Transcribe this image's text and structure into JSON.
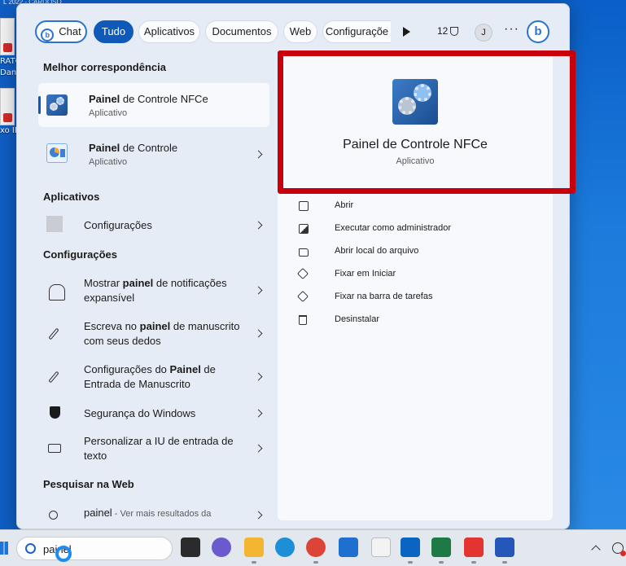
{
  "desktop": {
    "top_text": "L 2022 - CARDOSO",
    "labels": [
      "RATO",
      "Danie",
      "xo II"
    ]
  },
  "topbar": {
    "chat_label": "Chat",
    "chat_icon_glyph": "b",
    "tabs": [
      "Tudo",
      "Aplicativos",
      "Documentos",
      "Web",
      "Configuraçõe"
    ],
    "active_tab": "Tudo",
    "points": "12",
    "avatar_initial": "J",
    "more_glyph": "···",
    "bing_glyph": "b"
  },
  "left": {
    "best_match_heading": "Melhor correspondência",
    "best_match": {
      "title_bold": "Painel",
      "title_rest": " de Controle NFCe",
      "subtitle": "Aplicativo"
    },
    "second_match": {
      "title_bold": "Painel",
      "title_rest": " de Controle",
      "subtitle": "Aplicativo"
    },
    "apps_heading": "Aplicativos",
    "apps": [
      {
        "label": "Configurações"
      }
    ],
    "settings_heading": "Configurações",
    "settings": [
      {
        "before": "Mostrar ",
        "bold": "painel",
        "after": " de notificações expansível",
        "icon": "bell-icon"
      },
      {
        "before": "Escreva no ",
        "bold": "painel",
        "after": " de manuscrito com seus dedos",
        "icon": "pen-icon"
      },
      {
        "before": "Configurações do ",
        "bold": "Painel",
        "after": " de Entrada de Manuscrito",
        "icon": "pen-icon"
      },
      {
        "before": "Segurança do Windows",
        "bold": "",
        "after": "",
        "icon": "shield-icon"
      },
      {
        "before": "Personalizar a IU de entrada de texto",
        "bold": "",
        "after": "",
        "icon": "keyboard-icon"
      }
    ],
    "web_heading": "Pesquisar na Web",
    "web": {
      "term": "painel",
      "rest": " - Ver mais resultados da"
    }
  },
  "detail": {
    "app_name": "Painel de Controle NFCe",
    "app_type": "Aplicativo",
    "actions": [
      {
        "label": "Abrir",
        "icon": "open-icon"
      },
      {
        "label": "Executar como administrador",
        "icon": "admin-icon"
      },
      {
        "label": "Abrir local do arquivo",
        "icon": "folder-icon"
      },
      {
        "label": "Fixar em Iniciar",
        "icon": "pin-icon"
      },
      {
        "label": "Fixar na barra de tarefas",
        "icon": "pin-icon"
      },
      {
        "label": "Desinstalar",
        "icon": "trash-icon"
      }
    ],
    "highlight_color": "#c8000c"
  },
  "taskbar": {
    "search_value": "painel",
    "apps": [
      {
        "name": "task-view",
        "color": "#2b2b2b"
      },
      {
        "name": "teams-chat",
        "color": "#6a5acd"
      },
      {
        "name": "file-explorer",
        "color": "#f2b632"
      },
      {
        "name": "edge",
        "color": "#1d8fd6"
      },
      {
        "name": "chrome",
        "color": "#db4437"
      },
      {
        "name": "store",
        "color": "#1f6fd1"
      },
      {
        "name": "notepad",
        "color": "#f3f3f3"
      },
      {
        "name": "outlook",
        "color": "#0a64c2"
      },
      {
        "name": "excel",
        "color": "#1d7a45"
      },
      {
        "name": "anydesk",
        "color": "#e3342f"
      },
      {
        "name": "word",
        "color": "#2557b8"
      }
    ]
  }
}
